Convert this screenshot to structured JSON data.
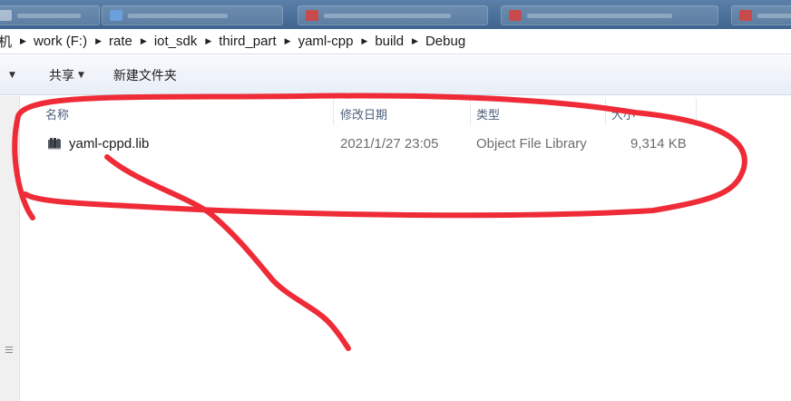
{
  "breadcrumb": {
    "root_partial": "机",
    "items": [
      "work (F:)",
      "rate",
      "iot_sdk",
      "third_part",
      "yaml-cpp",
      "build",
      "Debug"
    ]
  },
  "toolbar": {
    "share_label": "共享",
    "new_folder_label": "新建文件夹"
  },
  "columns": {
    "name": "名称",
    "date_modified": "修改日期",
    "type": "类型",
    "size_partial": "大小"
  },
  "files": [
    {
      "name": "yaml-cppd.lib",
      "date_modified": "2021/1/27 23:05",
      "type": "Object File Library",
      "size": "9,314 KB"
    }
  ],
  "colors": {
    "annotation": "#ee2b36",
    "header_text": "#4c607a",
    "meta_text": "#6d6d6d"
  },
  "icons": {
    "file": "library-file-icon",
    "dropdown": "chevron-down-icon",
    "separator": "breadcrumb-arrow-icon"
  }
}
